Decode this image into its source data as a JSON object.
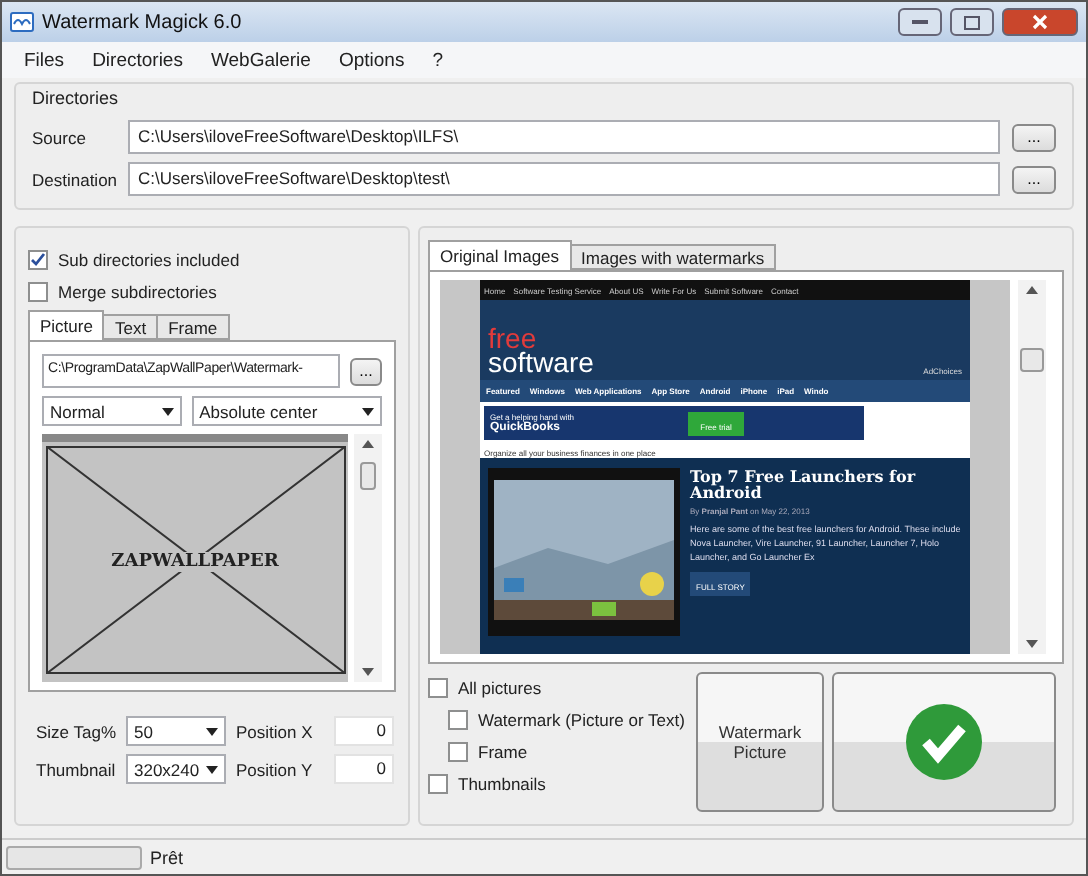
{
  "window": {
    "title": "Watermark Magick 6.0"
  },
  "menu": [
    "Files",
    "Directories",
    "WebGalerie",
    "Options",
    "?"
  ],
  "directories": {
    "title": "Directories",
    "source": {
      "label": "Source",
      "value": "C:\\Users\\iloveFreeSoftware\\Desktop\\ILFS\\",
      "button": "..."
    },
    "destination": {
      "label": "Destination",
      "value": "C:\\Users\\iloveFreeSoftware\\Desktop\\test\\",
      "button": "..."
    }
  },
  "options": [
    {
      "label": "Sub directories included",
      "checked": true
    },
    {
      "label": "Merge subdirectories",
      "checked": false
    }
  ],
  "left_tabs": [
    {
      "label": "Picture",
      "selected": true
    },
    {
      "label": "Text",
      "selected": false
    },
    {
      "label": "Frame",
      "selected": false
    }
  ],
  "picture_path": {
    "value": "C:\\ProgramData\\ZapWallPaper\\Watermark-",
    "button": "..."
  },
  "mode": "Normal",
  "position": "Absolute center",
  "watermark_preview": {
    "text": "ZAPWALLPAPER"
  },
  "size_fields": [
    {
      "label": "Size Tag%",
      "value": "50",
      "pos_label": "Position X",
      "pos_value": "0"
    },
    {
      "label": "Thumbnail",
      "value": "320x240",
      "pos_label": "Position Y",
      "pos_value": "0"
    }
  ],
  "right_tabs": [
    {
      "label": "Original Images",
      "selected": true
    },
    {
      "label": "Images with watermarks",
      "selected": false
    }
  ],
  "web_preview": {
    "nav": [
      "Home",
      "Software Testing Service",
      "About US",
      "Write For Us",
      "Submit Software",
      "Contact"
    ],
    "logo_top": "free",
    "logo_bottom": "software",
    "adchoices": "AdChoices",
    "categories": [
      "Featured",
      "Windows",
      "Web Applications",
      "App Store",
      "Android",
      "iPhone",
      "iPad",
      "Windo"
    ],
    "ad": {
      "line1": "Get a helping hand with",
      "brand": "QuickBooks",
      "button": "Free trial",
      "note": "Organize all your business finances in one place"
    },
    "article": {
      "title": "Top 7 Free Launchers for Android",
      "byline": "By **Pranjal Pant** on May 22, 2013",
      "body": "Here are some of the best free launchers for Android. These include Nova Launcher, Vire Launcher, 91 Launcher, Launcher 7, Holo Launcher, and Go Launcher Ex",
      "more": "FULL STORY"
    }
  },
  "targets": [
    {
      "label": "All pictures",
      "checked": false,
      "indent": false
    },
    {
      "label": "Watermark (Picture or Text)",
      "checked": false,
      "indent": true
    },
    {
      "label": "Frame",
      "checked": false,
      "indent": true
    },
    {
      "label": "Thumbnails",
      "checked": false,
      "indent": false
    }
  ],
  "buttons": {
    "watermark": "Watermark Picture"
  },
  "status_bar": {
    "text": "Prêt"
  }
}
